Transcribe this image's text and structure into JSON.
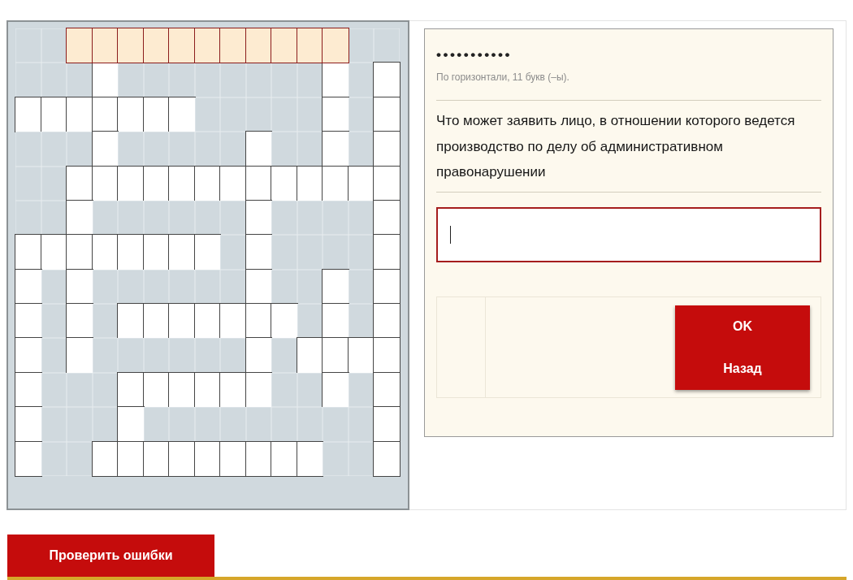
{
  "crossword": {
    "rows": [
      {
        "cells": [
          {
            "open": false,
            "selected": false
          },
          {
            "open": false,
            "selected": false
          },
          {
            "open": true,
            "selected": true
          },
          {
            "open": true,
            "selected": true
          },
          {
            "open": true,
            "selected": true
          },
          {
            "open": true,
            "selected": true
          },
          {
            "open": true,
            "selected": true
          },
          {
            "open": true,
            "selected": true
          },
          {
            "open": true,
            "selected": true
          },
          {
            "open": true,
            "selected": true
          },
          {
            "open": true,
            "selected": true
          },
          {
            "open": true,
            "selected": true
          },
          {
            "open": true,
            "selected": true
          },
          {
            "open": false,
            "selected": false
          },
          {
            "open": false,
            "selected": false
          }
        ]
      },
      {
        "cells": [
          {
            "open": false,
            "selected": false
          },
          {
            "open": false,
            "selected": false
          },
          {
            "open": false,
            "selected": false
          },
          {
            "open": true,
            "selected": false
          },
          {
            "open": false,
            "selected": false
          },
          {
            "open": false,
            "selected": false
          },
          {
            "open": false,
            "selected": false
          },
          {
            "open": false,
            "selected": false
          },
          {
            "open": false,
            "selected": false
          },
          {
            "open": false,
            "selected": false
          },
          {
            "open": false,
            "selected": false
          },
          {
            "open": false,
            "selected": false
          },
          {
            "open": true,
            "selected": false
          },
          {
            "open": false,
            "selected": false
          },
          {
            "open": true,
            "selected": false
          }
        ]
      },
      {
        "cells": [
          {
            "open": true,
            "selected": false
          },
          {
            "open": true,
            "selected": false
          },
          {
            "open": true,
            "selected": false
          },
          {
            "open": true,
            "selected": false
          },
          {
            "open": true,
            "selected": false
          },
          {
            "open": true,
            "selected": false
          },
          {
            "open": true,
            "selected": false
          },
          {
            "open": false,
            "selected": false
          },
          {
            "open": false,
            "selected": false
          },
          {
            "open": false,
            "selected": false
          },
          {
            "open": false,
            "selected": false
          },
          {
            "open": false,
            "selected": false
          },
          {
            "open": true,
            "selected": false
          },
          {
            "open": false,
            "selected": false
          },
          {
            "open": true,
            "selected": false
          }
        ]
      },
      {
        "cells": [
          {
            "open": false,
            "selected": false
          },
          {
            "open": false,
            "selected": false
          },
          {
            "open": false,
            "selected": false
          },
          {
            "open": true,
            "selected": false
          },
          {
            "open": false,
            "selected": false
          },
          {
            "open": false,
            "selected": false
          },
          {
            "open": false,
            "selected": false
          },
          {
            "open": false,
            "selected": false
          },
          {
            "open": false,
            "selected": false
          },
          {
            "open": true,
            "selected": false
          },
          {
            "open": false,
            "selected": false
          },
          {
            "open": false,
            "selected": false
          },
          {
            "open": true,
            "selected": false
          },
          {
            "open": false,
            "selected": false
          },
          {
            "open": true,
            "selected": false
          }
        ]
      },
      {
        "cells": [
          {
            "open": false,
            "selected": false
          },
          {
            "open": false,
            "selected": false
          },
          {
            "open": true,
            "selected": false
          },
          {
            "open": true,
            "selected": false
          },
          {
            "open": true,
            "selected": false
          },
          {
            "open": true,
            "selected": false
          },
          {
            "open": true,
            "selected": false
          },
          {
            "open": true,
            "selected": false
          },
          {
            "open": true,
            "selected": false
          },
          {
            "open": true,
            "selected": false
          },
          {
            "open": true,
            "selected": false
          },
          {
            "open": true,
            "selected": false
          },
          {
            "open": true,
            "selected": false
          },
          {
            "open": true,
            "selected": false
          },
          {
            "open": true,
            "selected": false
          }
        ]
      },
      {
        "cells": [
          {
            "open": false,
            "selected": false
          },
          {
            "open": false,
            "selected": false
          },
          {
            "open": true,
            "selected": false
          },
          {
            "open": false,
            "selected": false
          },
          {
            "open": false,
            "selected": false
          },
          {
            "open": false,
            "selected": false
          },
          {
            "open": false,
            "selected": false
          },
          {
            "open": false,
            "selected": false
          },
          {
            "open": false,
            "selected": false
          },
          {
            "open": true,
            "selected": false
          },
          {
            "open": false,
            "selected": false
          },
          {
            "open": false,
            "selected": false
          },
          {
            "open": false,
            "selected": false
          },
          {
            "open": false,
            "selected": false
          },
          {
            "open": true,
            "selected": false
          }
        ]
      },
      {
        "cells": [
          {
            "open": true,
            "selected": false
          },
          {
            "open": true,
            "selected": false
          },
          {
            "open": true,
            "selected": false
          },
          {
            "open": true,
            "selected": false
          },
          {
            "open": true,
            "selected": false
          },
          {
            "open": true,
            "selected": false
          },
          {
            "open": true,
            "selected": false
          },
          {
            "open": true,
            "selected": false
          },
          {
            "open": false,
            "selected": false
          },
          {
            "open": true,
            "selected": false
          },
          {
            "open": false,
            "selected": false
          },
          {
            "open": false,
            "selected": false
          },
          {
            "open": false,
            "selected": false
          },
          {
            "open": false,
            "selected": false
          },
          {
            "open": true,
            "selected": false
          }
        ]
      },
      {
        "cells": [
          {
            "open": true,
            "selected": false
          },
          {
            "open": false,
            "selected": false
          },
          {
            "open": true,
            "selected": false
          },
          {
            "open": false,
            "selected": false
          },
          {
            "open": false,
            "selected": false
          },
          {
            "open": false,
            "selected": false
          },
          {
            "open": false,
            "selected": false
          },
          {
            "open": false,
            "selected": false
          },
          {
            "open": false,
            "selected": false
          },
          {
            "open": true,
            "selected": false
          },
          {
            "open": false,
            "selected": false
          },
          {
            "open": false,
            "selected": false
          },
          {
            "open": true,
            "selected": false
          },
          {
            "open": false,
            "selected": false
          },
          {
            "open": true,
            "selected": false
          }
        ]
      },
      {
        "cells": [
          {
            "open": true,
            "selected": false
          },
          {
            "open": false,
            "selected": false
          },
          {
            "open": true,
            "selected": false
          },
          {
            "open": false,
            "selected": false
          },
          {
            "open": true,
            "selected": false
          },
          {
            "open": true,
            "selected": false
          },
          {
            "open": true,
            "selected": false
          },
          {
            "open": true,
            "selected": false
          },
          {
            "open": true,
            "selected": false
          },
          {
            "open": true,
            "selected": false
          },
          {
            "open": true,
            "selected": false
          },
          {
            "open": false,
            "selected": false
          },
          {
            "open": true,
            "selected": false
          },
          {
            "open": false,
            "selected": false
          },
          {
            "open": true,
            "selected": false
          }
        ]
      },
      {
        "cells": [
          {
            "open": true,
            "selected": false
          },
          {
            "open": false,
            "selected": false
          },
          {
            "open": true,
            "selected": false
          },
          {
            "open": false,
            "selected": false
          },
          {
            "open": false,
            "selected": false
          },
          {
            "open": false,
            "selected": false
          },
          {
            "open": false,
            "selected": false
          },
          {
            "open": false,
            "selected": false
          },
          {
            "open": false,
            "selected": false
          },
          {
            "open": true,
            "selected": false
          },
          {
            "open": false,
            "selected": false
          },
          {
            "open": true,
            "selected": false
          },
          {
            "open": true,
            "selected": false
          },
          {
            "open": true,
            "selected": false
          },
          {
            "open": true,
            "selected": false
          }
        ]
      },
      {
        "cells": [
          {
            "open": true,
            "selected": false
          },
          {
            "open": false,
            "selected": false
          },
          {
            "open": false,
            "selected": false
          },
          {
            "open": false,
            "selected": false
          },
          {
            "open": true,
            "selected": false
          },
          {
            "open": true,
            "selected": false
          },
          {
            "open": true,
            "selected": false
          },
          {
            "open": true,
            "selected": false
          },
          {
            "open": true,
            "selected": false
          },
          {
            "open": true,
            "selected": false
          },
          {
            "open": false,
            "selected": false
          },
          {
            "open": false,
            "selected": false
          },
          {
            "open": true,
            "selected": false
          },
          {
            "open": false,
            "selected": false
          },
          {
            "open": true,
            "selected": false
          }
        ]
      },
      {
        "cells": [
          {
            "open": true,
            "selected": false
          },
          {
            "open": false,
            "selected": false
          },
          {
            "open": false,
            "selected": false
          },
          {
            "open": false,
            "selected": false
          },
          {
            "open": true,
            "selected": false
          },
          {
            "open": false,
            "selected": false
          },
          {
            "open": false,
            "selected": false
          },
          {
            "open": false,
            "selected": false
          },
          {
            "open": false,
            "selected": false
          },
          {
            "open": false,
            "selected": false
          },
          {
            "open": false,
            "selected": false
          },
          {
            "open": false,
            "selected": false
          },
          {
            "open": false,
            "selected": false
          },
          {
            "open": false,
            "selected": false
          },
          {
            "open": true,
            "selected": false
          }
        ]
      },
      {
        "cells": [
          {
            "open": true,
            "selected": false
          },
          {
            "open": false,
            "selected": false
          },
          {
            "open": false,
            "selected": false
          },
          {
            "open": true,
            "selected": false
          },
          {
            "open": true,
            "selected": false
          },
          {
            "open": true,
            "selected": false
          },
          {
            "open": true,
            "selected": false
          },
          {
            "open": true,
            "selected": false
          },
          {
            "open": true,
            "selected": false
          },
          {
            "open": true,
            "selected": false
          },
          {
            "open": true,
            "selected": false
          },
          {
            "open": true,
            "selected": false
          },
          {
            "open": false,
            "selected": false
          },
          {
            "open": false,
            "selected": false
          },
          {
            "open": true,
            "selected": false
          }
        ]
      }
    ]
  },
  "clue_panel": {
    "answer_mask": "•••••••••••",
    "hint": "По горизонтали, 11 букв (–ы).",
    "question": "Что может заявить лицо, в отношении которого ведется производство по делу об административном правонарушении",
    "answer_field": {
      "focused": true
    },
    "buttons": [
      "OK",
      "Назад"
    ]
  },
  "check_button": "Проверить ошибки"
}
